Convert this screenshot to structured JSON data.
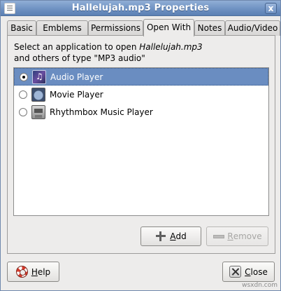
{
  "window": {
    "title": "Hallelujah.mp3 Properties",
    "close_glyph": "x"
  },
  "tabs": [
    {
      "label": "Basic"
    },
    {
      "label": "Emblems"
    },
    {
      "label": "Permissions"
    },
    {
      "label": "Open With",
      "active": true
    },
    {
      "label": "Notes"
    },
    {
      "label": "Audio/Video"
    }
  ],
  "description": {
    "line1_prefix": "Select an application to open ",
    "file_name": "Hallelujah.mp3",
    "line2": "and others of type \"MP3 audio\""
  },
  "applications": [
    {
      "name": "Audio Player",
      "icon": "audio-player-icon",
      "selected": true
    },
    {
      "name": "Movie Player",
      "icon": "movie-player-icon",
      "selected": false
    },
    {
      "name": "Rhythmbox Music Player",
      "icon": "rhythmbox-icon",
      "selected": false
    }
  ],
  "buttons": {
    "add_mnemonic": "A",
    "add_rest": "dd",
    "remove_mnemonic": "R",
    "remove_rest": "emove",
    "help_mnemonic": "H",
    "help_rest": "elp",
    "close_mnemonic": "C",
    "close_rest": "lose"
  },
  "watermark": "wsxdn.com",
  "colors": {
    "titlebar": "#6f92c2",
    "selection": "#6a8dc1",
    "window_bg": "#edeceb"
  }
}
